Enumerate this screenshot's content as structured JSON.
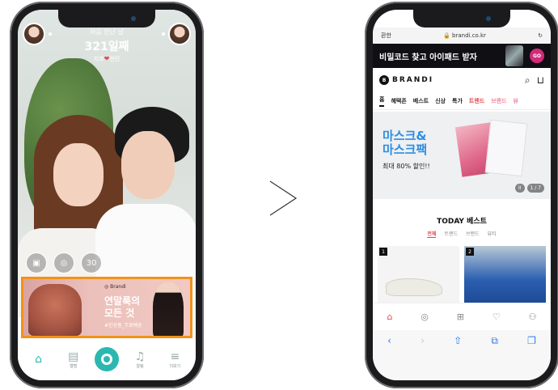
{
  "left_phone": {
    "counter": {
      "line1": "처음 만난 날",
      "line2": "321일째",
      "line3_prefix": "지호",
      "line3_suffix": "현민",
      "heart": "❤"
    },
    "tools": [
      {
        "icon": "photo-edit-icon",
        "glyph": "▣"
      },
      {
        "icon": "rings-icon",
        "glyph": "◎"
      },
      {
        "icon": "calendar-icon",
        "glyph": "30"
      }
    ],
    "ad": {
      "brand": "◎ Brandi",
      "title1": "연말룩의",
      "title2": "모든 것",
      "tag": "#한상품_무료배송",
      "border_color": "#f29218"
    },
    "tabs": [
      {
        "label": "",
        "icon": "home-icon",
        "glyph": "⌂",
        "active": true
      },
      {
        "label": "앨범",
        "icon": "album-icon",
        "glyph": "▤",
        "active": false
      },
      {
        "label": "",
        "icon": "center-button-icon",
        "glyph": "",
        "active": false
      },
      {
        "label": "알림",
        "icon": "bell-icon",
        "glyph": "♫",
        "active": false
      },
      {
        "label": "더보기",
        "icon": "menu-icon",
        "glyph": "≡",
        "active": false
      }
    ]
  },
  "arrow_glyph": "›",
  "right_phone": {
    "url": {
      "left": "환한",
      "domain": "🔒 brandi.co.kr",
      "reload": "↻"
    },
    "banner": {
      "text": "비밀코드 찾고 아이패드 받자",
      "go": "GO"
    },
    "brand": {
      "logo_icon": "B",
      "logo": "BRANDI",
      "search": "⌕",
      "cart": "⊔"
    },
    "categories": [
      {
        "label": "홈",
        "style": "sel"
      },
      {
        "label": "혜택존",
        "style": ""
      },
      {
        "label": "베스트",
        "style": ""
      },
      {
        "label": "신상",
        "style": ""
      },
      {
        "label": "특가",
        "style": ""
      },
      {
        "label": "트렌드",
        "style": "hot"
      },
      {
        "label": "브랜드",
        "style": "hot2"
      },
      {
        "label": "뷰",
        "style": "hot2"
      }
    ],
    "hero": {
      "title": "마스크&\n마스크팩",
      "sub": "최대 80% 할인!!",
      "pause": "II",
      "page": "1 / 7",
      "accent": "#2e8de0"
    },
    "section_title": "TODAY 베스트",
    "subtabs": [
      {
        "label": "전체",
        "on": true
      },
      {
        "label": "트렌드",
        "on": false
      },
      {
        "label": "브랜드",
        "on": false
      },
      {
        "label": "뷰티",
        "on": false
      }
    ],
    "products": [
      {
        "rank": "1"
      },
      {
        "rank": "2"
      }
    ],
    "tabs": [
      {
        "icon": "home-icon",
        "glyph": "⌂",
        "active": true
      },
      {
        "icon": "explore-icon",
        "glyph": "◎",
        "active": false
      },
      {
        "icon": "category-icon",
        "glyph": "⊞",
        "active": false
      },
      {
        "icon": "heart-icon",
        "glyph": "♡",
        "active": false
      },
      {
        "icon": "profile-icon",
        "glyph": "⚇",
        "active": false
      }
    ],
    "safari": [
      {
        "icon": "back-icon",
        "glyph": "‹",
        "dim": false
      },
      {
        "icon": "forward-icon",
        "glyph": "›",
        "dim": true
      },
      {
        "icon": "share-icon",
        "glyph": "⇧",
        "dim": false
      },
      {
        "icon": "bookmarks-icon",
        "glyph": "⧉",
        "dim": false
      },
      {
        "icon": "tabs-icon",
        "glyph": "❐",
        "dim": false
      }
    ]
  }
}
